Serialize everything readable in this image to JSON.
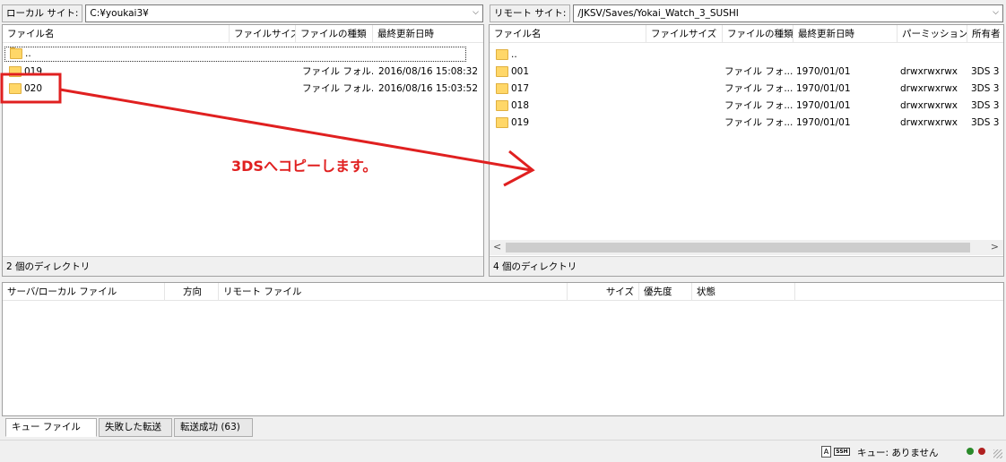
{
  "local": {
    "site_label": "ローカル サイト:",
    "path": "C:¥youkai3¥",
    "columns": [
      "ファイル名",
      "ファイルサイズ",
      "ファイルの種類",
      "最終更新日時"
    ],
    "rows": [
      {
        "name": "..",
        "size": "",
        "type": "",
        "modified": ""
      },
      {
        "name": "019",
        "size": "",
        "type": "ファイル フォル...",
        "modified": "2016/08/16 15:08:32"
      },
      {
        "name": "020",
        "size": "",
        "type": "ファイル フォル...",
        "modified": "2016/08/16 15:03:52"
      }
    ],
    "status": "2 個のディレクトリ"
  },
  "remote": {
    "site_label": "リモート サイト:",
    "path": "/JKSV/Saves/Yokai_Watch_3_SUSHI",
    "columns": [
      "ファイル名",
      "ファイルサイズ",
      "ファイルの種類",
      "最終更新日時",
      "パーミッション",
      "所有者"
    ],
    "rows": [
      {
        "name": "..",
        "size": "",
        "type": "",
        "modified": "",
        "perm": "",
        "owner": ""
      },
      {
        "name": "001",
        "size": "",
        "type": "ファイル フォ...",
        "modified": "1970/01/01",
        "perm": "drwxrwxrwx",
        "owner": "3DS 3"
      },
      {
        "name": "017",
        "size": "",
        "type": "ファイル フォ...",
        "modified": "1970/01/01",
        "perm": "drwxrwxrwx",
        "owner": "3DS 3"
      },
      {
        "name": "018",
        "size": "",
        "type": "ファイル フォ...",
        "modified": "1970/01/01",
        "perm": "drwxrwxrwx",
        "owner": "3DS 3"
      },
      {
        "name": "019",
        "size": "",
        "type": "ファイル フォ...",
        "modified": "1970/01/01",
        "perm": "drwxrwxrwx",
        "owner": "3DS 3"
      }
    ],
    "status": "4 個のディレクトリ"
  },
  "annotation": {
    "text": "3DSへコピーします。",
    "color": "#e02020"
  },
  "queue": {
    "columns": [
      "サーバ/ローカル ファイル",
      "方向",
      "リモート ファイル",
      "サイズ",
      "優先度",
      "状態"
    ],
    "tabs": [
      "キュー ファイル",
      "失敗した転送",
      "転送成功 (63)"
    ]
  },
  "statusbar": {
    "queue_text": "キュー: ありません",
    "icons": [
      "binary-mode-icon",
      "sftp-icon",
      "transfer-led-green-icon",
      "transfer-led-red-icon"
    ]
  }
}
